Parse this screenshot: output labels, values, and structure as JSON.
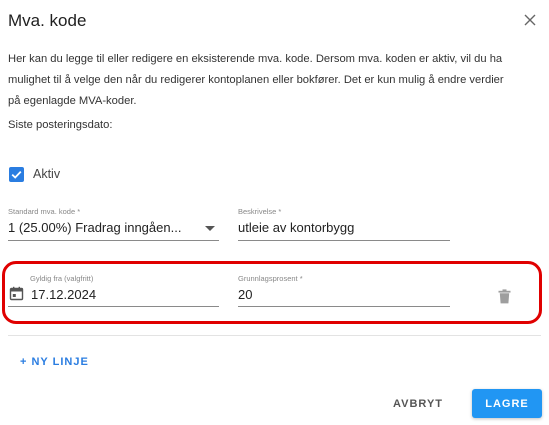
{
  "dialog": {
    "title": "Mva. kode",
    "description": "Her kan du legge til eller redigere en eksisterende mva. kode. Dersom mva. koden er aktiv, vil du ha mulighet til å velge den når du redigerer kontoplanen eller bokfører. Det er kun mulig å endre verdier på egenlagde MVA-koder.",
    "last_posting_date_label": "Siste posteringsdato:"
  },
  "active": {
    "label": "Aktiv",
    "checked": true
  },
  "fields": {
    "standard_vat_code": {
      "label": "Standard mva. kode *",
      "value": "1 (25.00%) Fradrag inngåen..."
    },
    "description": {
      "label": "Beskrivelse *",
      "value": "utleie av kontorbygg"
    }
  },
  "line": {
    "valid_from": {
      "label": "Gyldig fra (valgfritt)",
      "value": "17.12.2024"
    },
    "basis_percent": {
      "label": "Grunnlagsprosent *",
      "value": "20"
    }
  },
  "actions": {
    "add_line": "+ NY LINJE",
    "cancel": "AVBRYT",
    "save": "LAGRE"
  },
  "icons": {
    "close": "close-icon",
    "checkbox": "check-icon",
    "dropdown": "chevron-down-icon",
    "calendar": "calendar-icon",
    "delete": "trash-icon"
  },
  "colors": {
    "accent": "#2196f3",
    "highlight": "#e00000"
  }
}
